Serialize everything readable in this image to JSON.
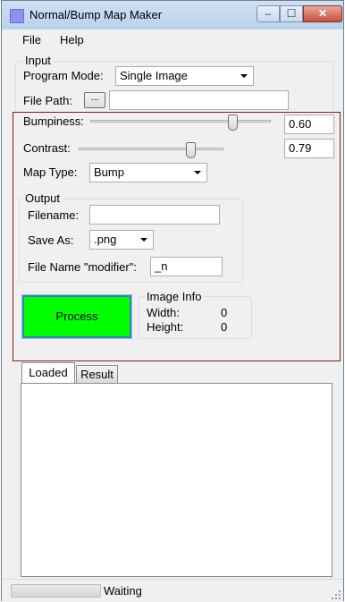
{
  "window": {
    "title": "Normal/Bump Map Maker",
    "icon": "app-icon-square",
    "controls": {
      "minimize": "‒",
      "maximize": "☐",
      "close": "✕"
    }
  },
  "menu": {
    "file": "File",
    "help": "Help"
  },
  "input": {
    "group_label": "Input",
    "program_mode_label": "Program Mode:",
    "program_mode_value": "Single Image",
    "file_path_label": "File Path:",
    "browse_label": "...",
    "file_path_value": ""
  },
  "settings": {
    "bumpiness_label": "Bumpiness:",
    "bumpiness_value": "0.60",
    "contrast_label": "Contrast:",
    "contrast_value": "0.79",
    "map_type_label": "Map Type:",
    "map_type_value": "Bump"
  },
  "output": {
    "group_label": "Output",
    "filename_label": "Filename:",
    "filename_value": "",
    "save_as_label": "Save As:",
    "save_as_value": ".png",
    "modifier_label": "File Name \"modifier\":",
    "modifier_value": "_n"
  },
  "process_label": "Process",
  "image_info": {
    "group_label": "Image Info",
    "width_label": "Width:",
    "width_value": "0",
    "height_label": "Height:",
    "height_value": "0"
  },
  "tabs": [
    {
      "label": "Loaded"
    },
    {
      "label": "Result"
    }
  ],
  "status": {
    "text": "Waiting"
  },
  "colors": {
    "process_button": "#00ff00",
    "frame": "#8b1a1a",
    "window_bg": "#f0f0f0"
  }
}
